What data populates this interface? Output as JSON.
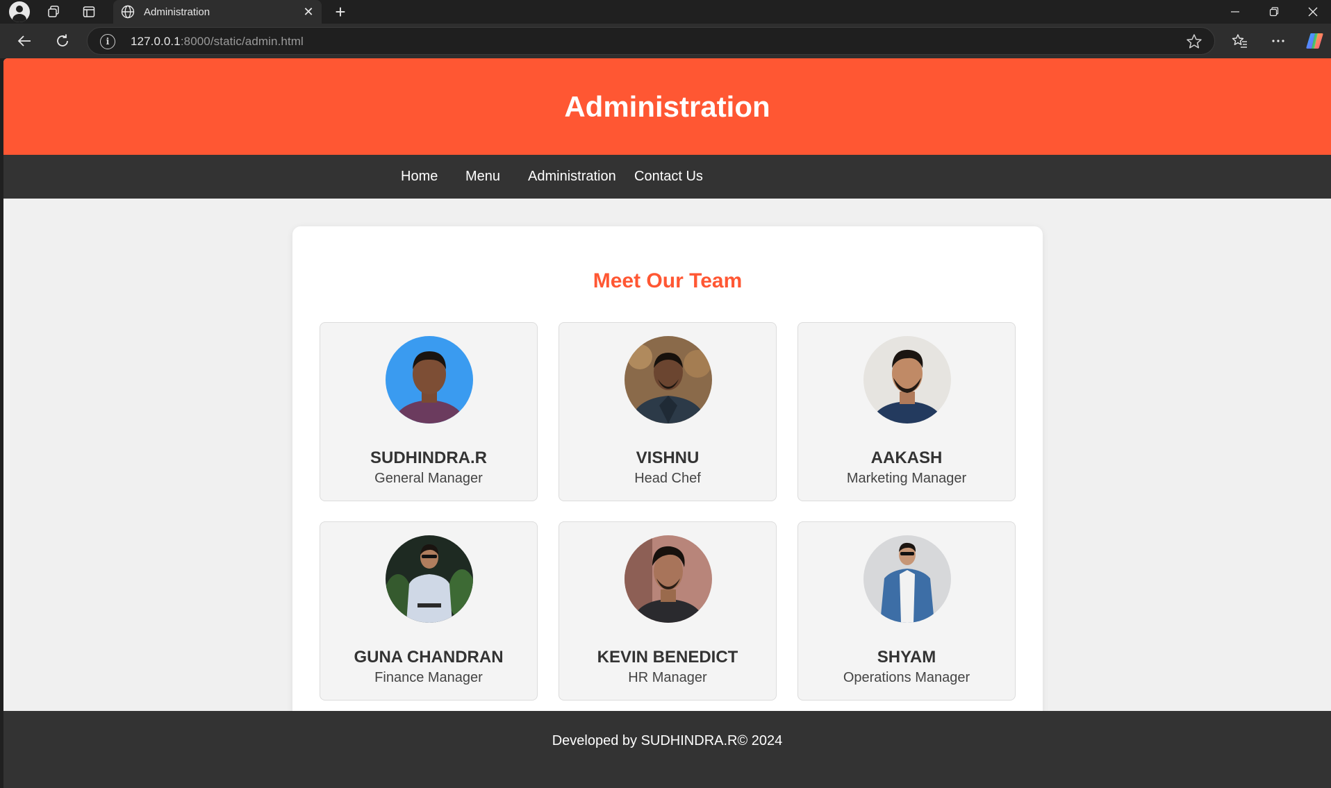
{
  "browser": {
    "tab_title": "Administration",
    "url_host": "127.0.0.1",
    "url_rest": ":8000/static/admin.html"
  },
  "page": {
    "header_title": "Administration",
    "nav": [
      {
        "label": "Home"
      },
      {
        "label": "Menu"
      },
      {
        "label": "Administration"
      },
      {
        "label": "Contact Us"
      }
    ],
    "section_title": "Meet Our Team",
    "team": [
      {
        "name": "SUDHINDRA.R",
        "role": "General Manager"
      },
      {
        "name": "VISHNU",
        "role": "Head Chef"
      },
      {
        "name": "AAKASH",
        "role": "Marketing Manager"
      },
      {
        "name": "GUNA CHANDRAN",
        "role": "Finance Manager"
      },
      {
        "name": "KEVIN BENEDICT",
        "role": "HR Manager"
      },
      {
        "name": "SHYAM",
        "role": "Operations Manager"
      }
    ],
    "footer": "Developed by SUDHINDRA.R© 2024"
  },
  "colors": {
    "accent": "#ff5733",
    "nav_bg": "#333333",
    "page_bg": "#f0f0f0"
  }
}
